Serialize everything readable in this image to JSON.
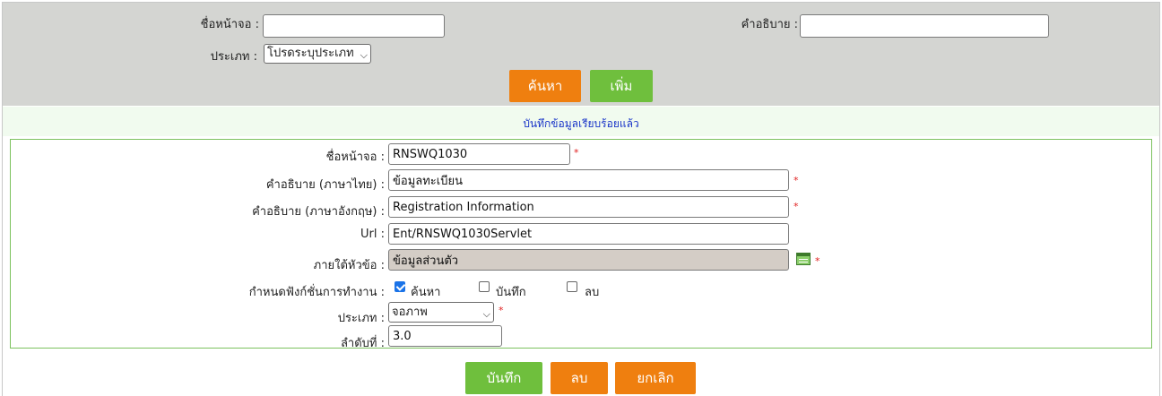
{
  "search": {
    "screen_name_label": "ชื่อหน้าจอ :",
    "screen_name_value": "",
    "description_label": "คำอธิบาย :",
    "description_value": "",
    "type_label": "ประเภท :",
    "type_selected": "โปรดระบุประเภท",
    "search_button": "ค้นหา",
    "add_button": "เพิ่ม"
  },
  "message": "บันทึกข้อมูลเรียบร้อยแล้ว",
  "form": {
    "screen_name_label": "ชื่อหน้าจอ :",
    "screen_name_value": "RNSWQ1030",
    "desc_th_label": "คำอธิบาย (ภาษาไทย) :",
    "desc_th_value": "ข้อมูลทะเบียน",
    "desc_en_label": "คำอธิบาย (ภาษาอังกฤษ) :",
    "desc_en_value": "Registration Information",
    "url_label": "Url :",
    "url_value": "Ent/RNSWQ1030Servlet",
    "parent_label": "ภายใต้หัวข้อ :",
    "parent_value": "ข้อมูลส่วนตัว",
    "functions_label": "กำหนดฟังก์ชั่นการทำงาน :",
    "functions": [
      {
        "label": "ค้นหา",
        "checked": true
      },
      {
        "label": "บันทึก",
        "checked": false
      },
      {
        "label": "ลบ",
        "checked": false
      }
    ],
    "type_label": "ประเภท :",
    "type_selected": "จอภาพ",
    "order_label": "ลำดับที่ :",
    "order_value": "3.0",
    "required_mark": "*"
  },
  "actions": {
    "save": "บันทึก",
    "delete": "ลบ",
    "cancel": "ยกเลิก"
  },
  "colors": {
    "orange": "#ef7f0f",
    "green": "#6fbf3d",
    "message_blue": "#1a35c8",
    "required_red": "#e02020"
  }
}
